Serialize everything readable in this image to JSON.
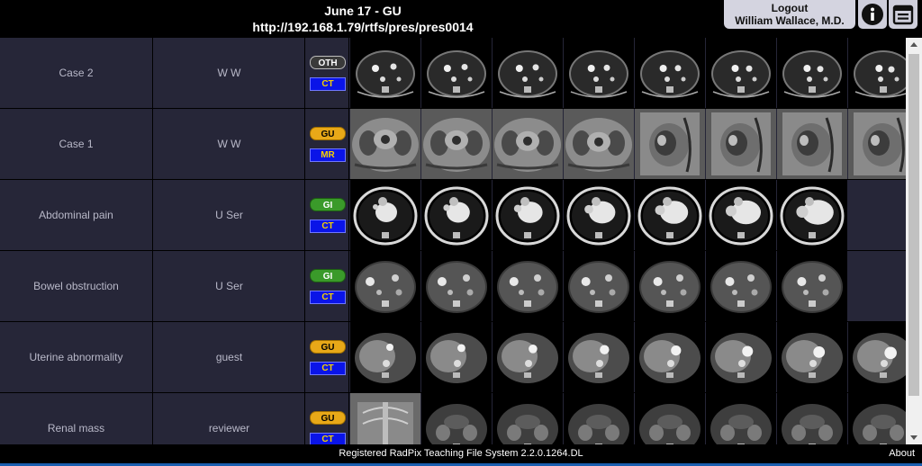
{
  "header": {
    "title": "June 17 - GU",
    "url": "http://192.168.1.79/rtfs/pres/pres0014",
    "logout_label": "Logout",
    "user_name": "William Wallace, M.D.",
    "info_icon": "info-icon",
    "calendar_icon": "calendar-icon"
  },
  "cases": [
    {
      "description": "Case 2",
      "user": "W W",
      "tag": "OTH",
      "modality": "CT",
      "thumbnail_count": 8,
      "scan": "abdomen-ct"
    },
    {
      "description": "Case 1",
      "user": "W W",
      "tag": "GU",
      "modality": "MR",
      "thumbnail_count": 8,
      "scan": "pelvis-mr"
    },
    {
      "description": "Abdominal pain",
      "user": "U Ser",
      "tag": "GI",
      "modality": "CT",
      "thumbnail_count": 7,
      "scan": "chest-ct"
    },
    {
      "description": "Bowel obstruction",
      "user": "U Ser",
      "tag": "GI",
      "modality": "CT",
      "thumbnail_count": 7,
      "scan": "abdomen-ct-dark"
    },
    {
      "description": "Uterine abnormality",
      "user": "guest",
      "tag": "GU",
      "modality": "CT",
      "thumbnail_count": 8,
      "scan": "liver-ct"
    },
    {
      "description": "Renal mass",
      "user": "reviewer",
      "tag": "GU",
      "modality": "CT",
      "thumbnail_count": 8,
      "scan": "renal-ct"
    }
  ],
  "footer": {
    "registered": "Registered RadPix Teaching File System 2.2.0.1264.DL",
    "about": "About"
  },
  "colors": {
    "row_bg": "#262638",
    "tag_gu": "#e8a818",
    "tag_gi": "#3a9a2a",
    "tag_oth": "#3a3a3a",
    "modality_bg": "#0a14e8",
    "modality_text": "#f5d000"
  }
}
